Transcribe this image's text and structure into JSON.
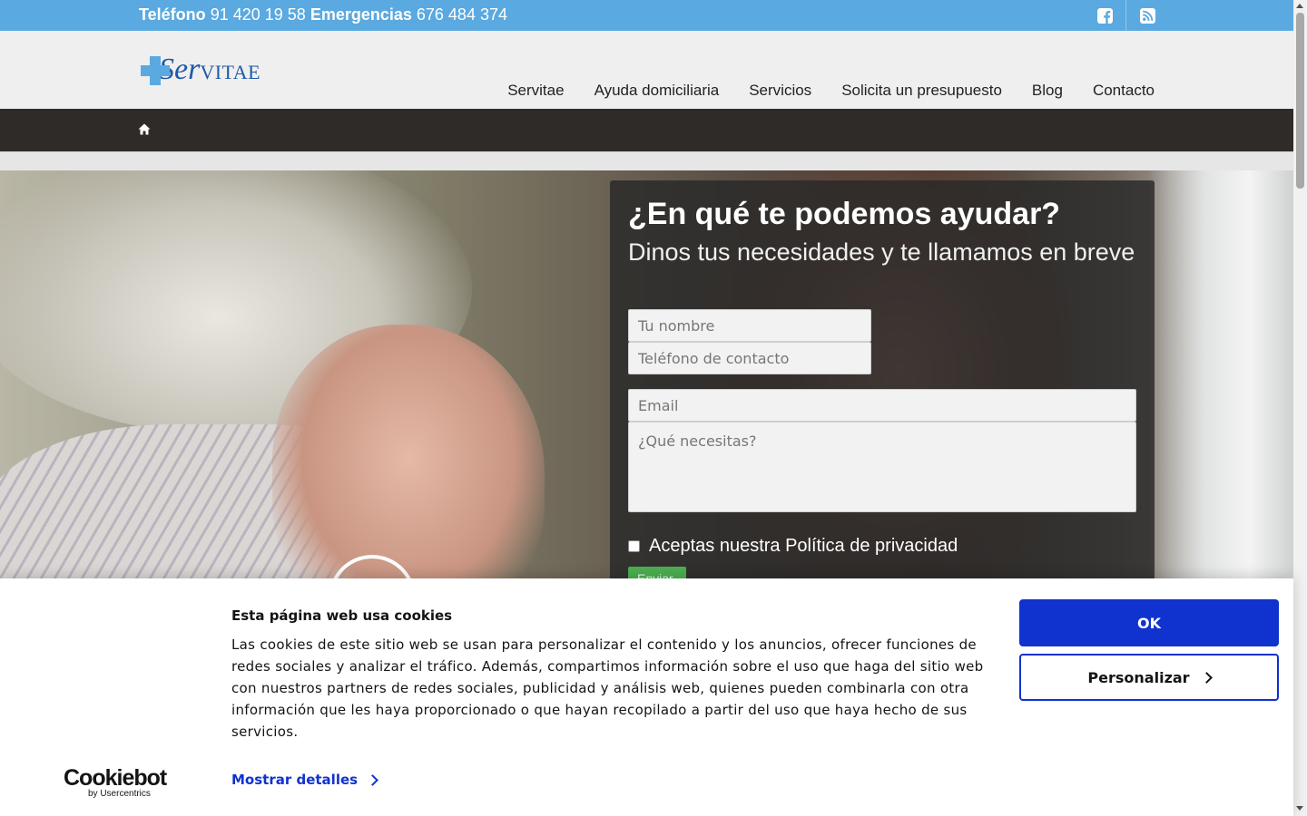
{
  "topbar": {
    "phone_label": "Teléfono",
    "phone_number": "91 420 19 58",
    "emergency_label": "Emergencias",
    "emergency_number": "676 484 374",
    "social": [
      "facebook-icon",
      "rss-icon"
    ]
  },
  "header": {
    "logo_ser": "Ser",
    "logo_vitae": "VITAE",
    "nav": [
      {
        "label": "Servitae"
      },
      {
        "label": "Ayuda domiciliaria"
      },
      {
        "label": "Servicios"
      },
      {
        "label": "Solicita un presupuesto"
      },
      {
        "label": "Blog"
      },
      {
        "label": "Contacto"
      }
    ]
  },
  "breadcrumb": {
    "icon": "home-icon"
  },
  "form": {
    "title": "¿En qué te podemos ayudar?",
    "subtitle": "Dinos tus necesidades y te llamamos en breve",
    "name_placeholder": "Tu nombre",
    "phone_placeholder": "Teléfono de contacto",
    "email_placeholder": "Email",
    "message_placeholder": "¿Qué necesitas?",
    "privacy_label": "Aceptas nuestra Política de privacidad",
    "submit_label": "Enviar"
  },
  "cookie_banner": {
    "title": "Esta página web usa cookies",
    "text": "Las cookies de este sitio web se usan para personalizar el contenido y los anuncios, ofrecer funciones de redes sociales y analizar el tráfico. Además, compartimos información sobre el uso que haga del sitio web con nuestros partners de redes sociales, publicidad y análisis web, quienes pueden combinarla con otra información que les haya proporcionado o que hayan recopilado a partir del uso que haya hecho de sus servicios.",
    "details_link": "Mostrar detalles",
    "ok_button": "OK",
    "customize_button": "Personalizar",
    "brand": "Cookiebot",
    "brand_by": "by Usercentrics"
  },
  "colors": {
    "topbar": "#5aa9e0",
    "header": "#efefef",
    "crumbbar": "#2f2b29",
    "cookie_accent": "#1032cf",
    "logo_blue": "#1f5aa6"
  }
}
